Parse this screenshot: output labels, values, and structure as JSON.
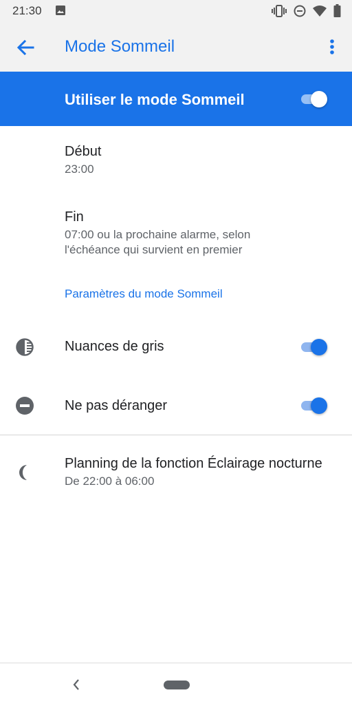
{
  "status_bar": {
    "time": "21:30",
    "icons": [
      "image-icon",
      "vibrate-icon",
      "dnd-icon",
      "wifi-icon",
      "battery-icon"
    ]
  },
  "app_bar": {
    "title": "Mode Sommeil",
    "back_icon": "arrow-back-icon",
    "menu_icon": "more-vert-icon"
  },
  "master_switch": {
    "label": "Utiliser le mode Sommeil",
    "on": true
  },
  "schedule": {
    "start": {
      "title": "Début",
      "value": "23:00"
    },
    "end": {
      "title": "Fin",
      "value_line1": "07:00 ou la prochaine alarme, selon",
      "value_line2": "l'échéance qui survient en premier"
    }
  },
  "settings": {
    "category_title": "Paramètres du mode Sommeil",
    "items": [
      {
        "label": "Nuances de gris",
        "icon": "grayscale-icon",
        "on": true
      },
      {
        "label": "Ne pas déranger",
        "icon": "do-not-disturb-icon",
        "on": true
      }
    ]
  },
  "night_light": {
    "title": "Planning de la fonction Éclairage nocturne",
    "subtitle": "De 22:00 à 06:00",
    "icon": "moon-icon"
  },
  "colors": {
    "accent": "#1a73e8",
    "app_bar_background": "#f2f2f2",
    "secondary_text": "#5f6368"
  }
}
